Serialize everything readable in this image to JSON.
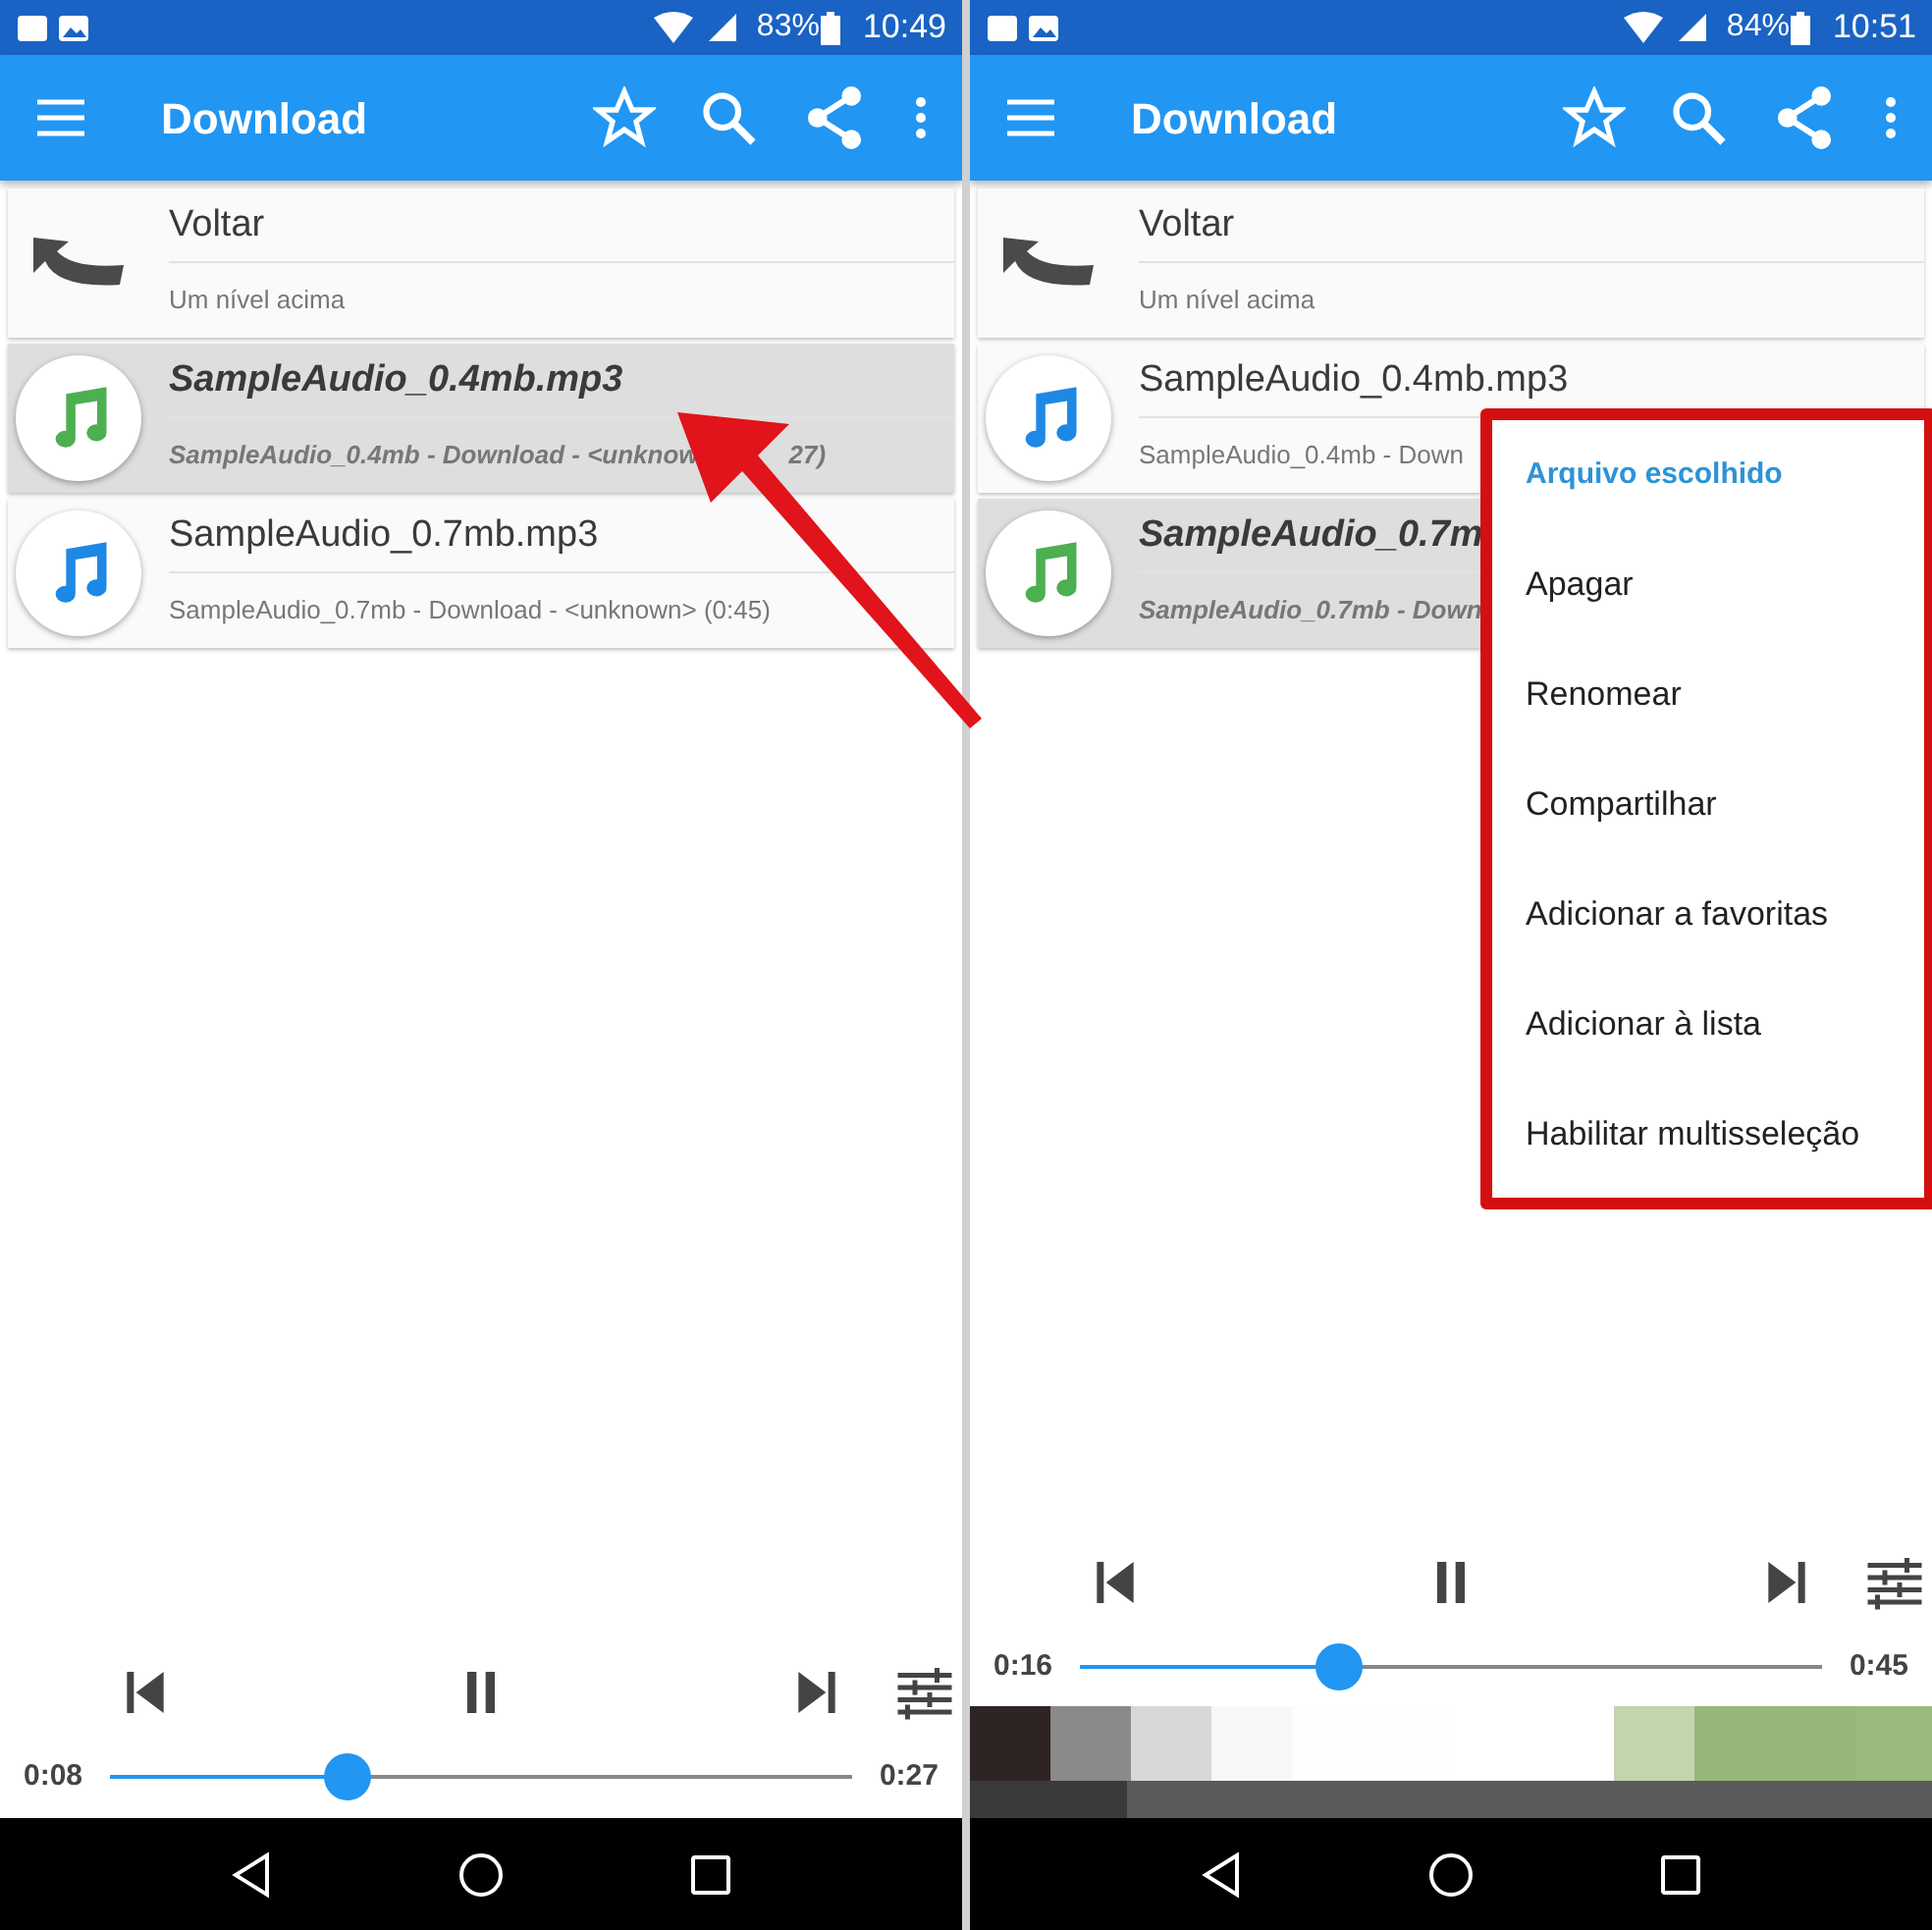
{
  "panels": [
    {
      "status_bar": {
        "battery": "83%",
        "time": "10:49"
      },
      "app_bar": {
        "title": "Download"
      },
      "items": [
        {
          "kind": "up",
          "title": "Voltar",
          "subtitle": "Um nível acima",
          "selected": false
        },
        {
          "kind": "audio",
          "title": "SampleAudio_0.4mb.mp3",
          "subtitle": [
            "SampleAudio_0.4mb - Download - <unknow",
            "27)"
          ],
          "selected": true,
          "color": "#4caf50"
        },
        {
          "kind": "audio",
          "title": "SampleAudio_0.7mb.mp3",
          "subtitle": "SampleAudio_0.7mb - Download - <unknown> (0:45)",
          "selected": false,
          "color": "#1e88e5"
        }
      ],
      "player": {
        "elapsed": "0:08",
        "total": "0:27",
        "level": 0.32
      }
    },
    {
      "status_bar": {
        "battery": "84%",
        "time": "10:51"
      },
      "app_bar": {
        "title": "Download"
      },
      "items": [
        {
          "kind": "up",
          "title": "Voltar",
          "subtitle": "Um nível acima",
          "selected": false
        },
        {
          "kind": "audio",
          "title": "SampleAudio_0.4mb.mp3",
          "subtitle": "SampleAudio_0.4mb - Down",
          "selected": false,
          "color": "#1e88e5"
        },
        {
          "kind": "audio",
          "title": "SampleAudio_0.7m",
          "subtitle": "SampleAudio_0.7mb - Down",
          "selected": true,
          "color": "#4caf50"
        }
      ],
      "context_menu": {
        "title": "Arquivo escolhido",
        "items": [
          "Apagar",
          "Renomear",
          "Compartilhar",
          "Adicionar a favoritas",
          "Adicionar à lista",
          "Habilitar multisseleção"
        ]
      },
      "player": {
        "elapsed": "0:16",
        "total": "0:45",
        "level": 0.35
      }
    }
  ]
}
